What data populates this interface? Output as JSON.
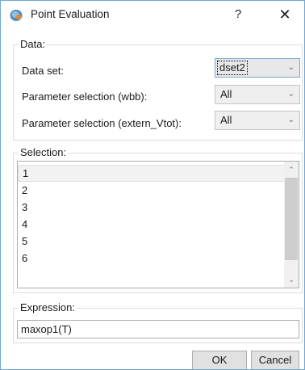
{
  "window": {
    "title": "Point Evaluation",
    "help_label": "?",
    "close_label": "✕",
    "icon": "app-icon"
  },
  "data_group": {
    "label": "Data:",
    "dataset_label": "Data set:",
    "dataset_value": "dset2",
    "param_wbb_label": "Parameter selection (wbb):",
    "param_wbb_value": "All",
    "param_vtot_label": "Parameter selection (extern_Vtot):",
    "param_vtot_value": "All"
  },
  "selection_group": {
    "label": "Selection:",
    "items": [
      "1",
      "2",
      "3",
      "4",
      "5",
      "6"
    ],
    "selected_index": 0
  },
  "expression_group": {
    "label": "Expression:",
    "value": "maxop1(T)"
  },
  "buttons": {
    "ok": "OK",
    "cancel": "Cancel"
  },
  "colors": {
    "accent_border": "#6fa7d6",
    "focus_border": "#7aa7d8"
  }
}
